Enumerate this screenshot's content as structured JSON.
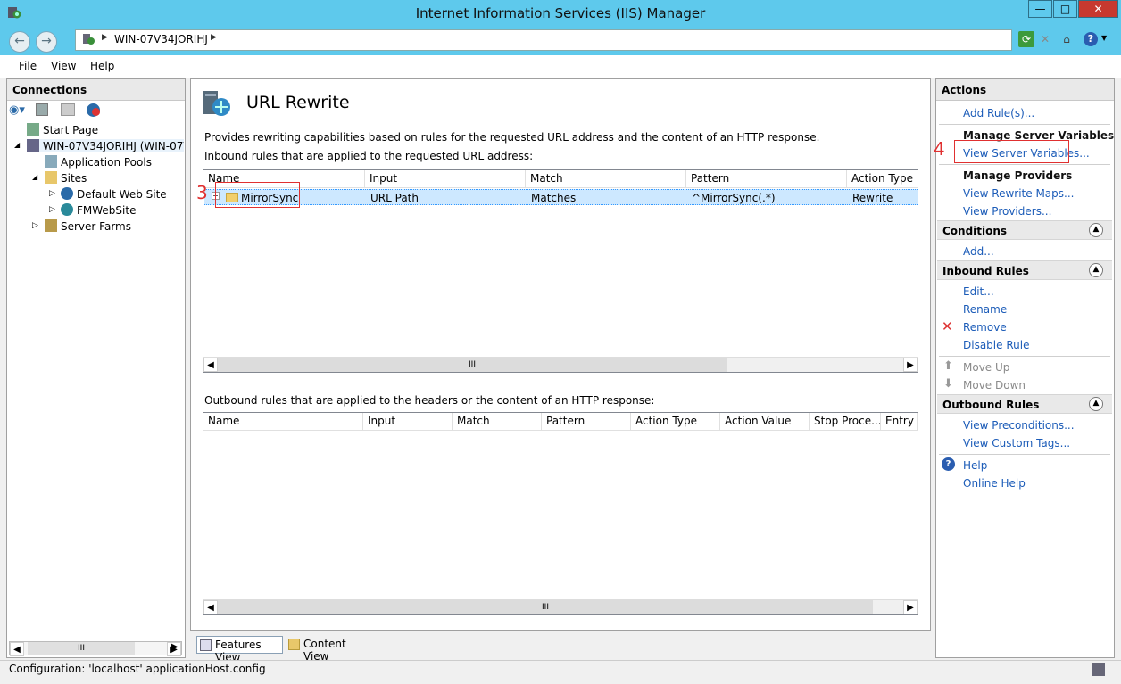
{
  "window": {
    "title": "Internet Information Services (IIS) Manager",
    "close_glyph": "✕",
    "max_glyph": "□",
    "min_glyph": "—"
  },
  "address": {
    "breadcrumb": "WIN-07V34JORIHJ"
  },
  "menu": [
    "File",
    "View",
    "Help"
  ],
  "connections": {
    "header": "Connections",
    "tree": [
      {
        "label": "Start Page",
        "icon": "start-page-icon"
      },
      {
        "label": "WIN-07V34JORIHJ (WIN-07V3",
        "icon": "server-icon"
      },
      {
        "label": "Application Pools",
        "icon": "app-pools-icon"
      },
      {
        "label": "Sites",
        "icon": "sites-folder-icon"
      },
      {
        "label": "Default Web Site",
        "icon": "globe-icon"
      },
      {
        "label": "FMWebSite",
        "icon": "globe-icon"
      },
      {
        "label": "Server Farms",
        "icon": "server-farms-icon"
      }
    ]
  },
  "feature": {
    "title": "URL Rewrite",
    "description": "Provides rewriting capabilities based on rules for the requested URL address and the content of an HTTP response.",
    "inbound_caption": "Inbound rules that are applied to the requested URL address:",
    "inbound_columns": [
      "Name",
      "Input",
      "Match",
      "Pattern",
      "Action Type"
    ],
    "inbound_rows": [
      {
        "name": "MirrorSync",
        "input": "URL Path",
        "match": "Matches",
        "pattern": "^MirrorSync(.*)",
        "action": "Rewrite"
      }
    ],
    "outbound_caption": "Outbound rules that are applied to the headers or the content of an HTTP response:",
    "outbound_columns": [
      "Name",
      "Input",
      "Match",
      "Pattern",
      "Action Type",
      "Action Value",
      "Stop Proce...",
      "Entry T"
    ]
  },
  "view_tabs": {
    "features": "Features View",
    "content": "Content View"
  },
  "actions": {
    "header": "Actions",
    "add_rules": "Add Rule(s)...",
    "manage_server_variables": "Manage Server Variables",
    "view_server_variables": "View Server Variables...",
    "manage_providers": "Manage Providers",
    "view_rewrite_maps": "View Rewrite Maps...",
    "view_providers": "View Providers...",
    "conditions": "Conditions",
    "add": "Add...",
    "inbound_rules": "Inbound Rules",
    "edit": "Edit...",
    "rename": "Rename",
    "remove": "Remove",
    "disable_rule": "Disable Rule",
    "move_up": "Move Up",
    "move_down": "Move Down",
    "outbound_rules": "Outbound Rules",
    "view_preconditions": "View Preconditions...",
    "view_custom_tags": "View Custom Tags...",
    "help": "Help",
    "online_help": "Online Help"
  },
  "annotations": {
    "step3": "3",
    "step4": "4"
  },
  "status": "Configuration: 'localhost' applicationHost.config",
  "scroll_glyph": "III",
  "colors": {
    "titlebar": "#5ec9ec",
    "link": "#1c5cb8",
    "selection": "#cde8ff",
    "annotation": "#e03030"
  }
}
